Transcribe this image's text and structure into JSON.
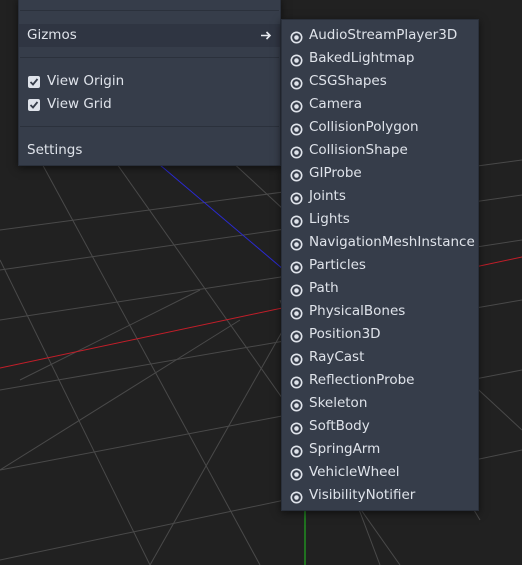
{
  "colors": {
    "background": "#212121",
    "menu_bg": "#363d4a",
    "menu_hover": "#2f3542",
    "text": "#dfe3ea",
    "grid_line": "#6a6a6a",
    "axis_x": "#c21e29",
    "axis_y": "#1ec21e",
    "axis_z": "#2a2ad0"
  },
  "view_menu": {
    "gizmos_label": "Gizmos",
    "gizmos_arrow_icon": "arrow-right-icon",
    "view_origin_label": "View Origin",
    "view_origin_checked": true,
    "view_grid_label": "View Grid",
    "view_grid_checked": true,
    "settings_label": "Settings"
  },
  "gizmos_menu": {
    "item_icon": "eye-icon",
    "items": [
      {
        "label": "AudioStreamPlayer3D"
      },
      {
        "label": "BakedLightmap"
      },
      {
        "label": "CSGShapes"
      },
      {
        "label": "Camera"
      },
      {
        "label": "CollisionPolygon"
      },
      {
        "label": "CollisionShape"
      },
      {
        "label": "GIProbe"
      },
      {
        "label": "Joints"
      },
      {
        "label": "Lights"
      },
      {
        "label": "NavigationMeshInstance"
      },
      {
        "label": "Particles"
      },
      {
        "label": "Path"
      },
      {
        "label": "PhysicalBones"
      },
      {
        "label": "Position3D"
      },
      {
        "label": "RayCast"
      },
      {
        "label": "ReflectionProbe"
      },
      {
        "label": "Skeleton"
      },
      {
        "label": "SoftBody"
      },
      {
        "label": "SpringArm"
      },
      {
        "label": "VehicleWheel"
      },
      {
        "label": "VisibilityNotifier"
      }
    ]
  }
}
